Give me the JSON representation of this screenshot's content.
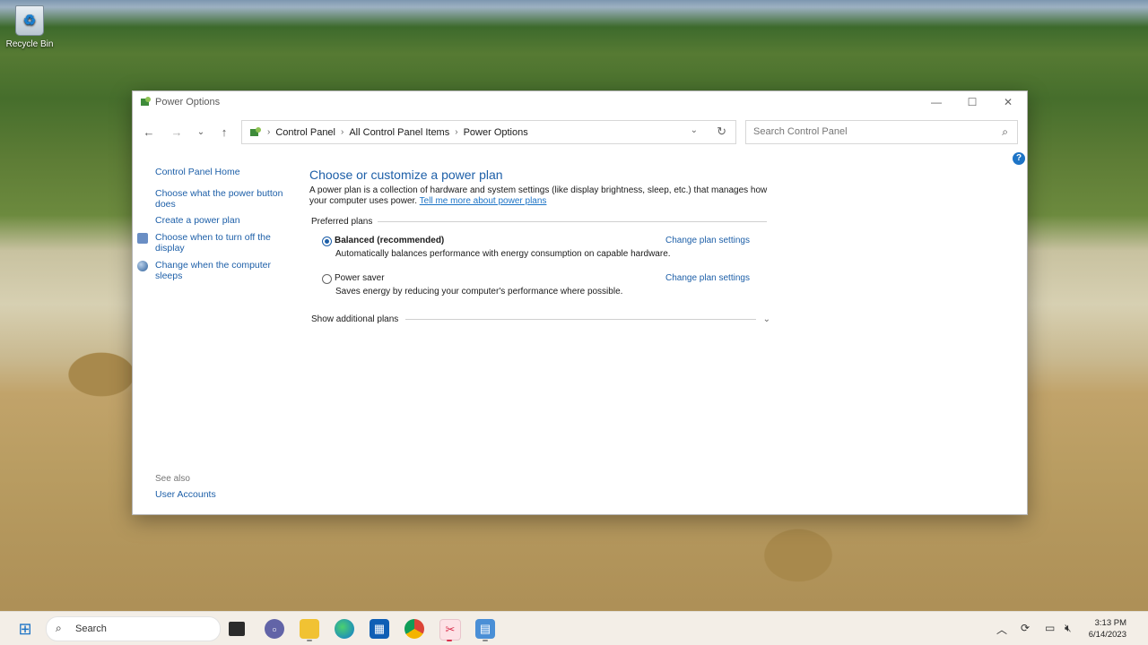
{
  "desktop": {
    "recycle_bin_label": "Recycle Bin"
  },
  "window": {
    "title": "Power Options",
    "breadcrumb": [
      "Control Panel",
      "All Control Panel Items",
      "Power Options"
    ],
    "search_placeholder": "Search Control Panel",
    "help_label": "?"
  },
  "sidebar": {
    "home": "Control Panel Home",
    "links": [
      "Choose what the power button does",
      "Create a power plan",
      "Choose when to turn off the display",
      "Change when the computer sleeps"
    ],
    "see_also_title": "See also",
    "see_also_links": [
      "User Accounts"
    ]
  },
  "main": {
    "heading": "Choose or customize a power plan",
    "description": "A power plan is a collection of hardware and system settings (like display brightness, sleep, etc.) that manages how your computer uses power.",
    "description_link": "Tell me more about power plans",
    "preferred_plans_label": "Preferred plans",
    "plans": [
      {
        "name": "Balanced (recommended)",
        "description": "Automatically balances performance with energy consumption on capable hardware.",
        "link": "Change plan settings",
        "selected": true
      },
      {
        "name": "Power saver",
        "description": "Saves energy by reducing your computer's performance where possible.",
        "link": "Change plan settings",
        "selected": false
      }
    ],
    "show_additional_plans": "Show additional plans"
  },
  "taskbar": {
    "search_label": "Search",
    "time": "3:13 PM",
    "date": "6/14/2023"
  }
}
